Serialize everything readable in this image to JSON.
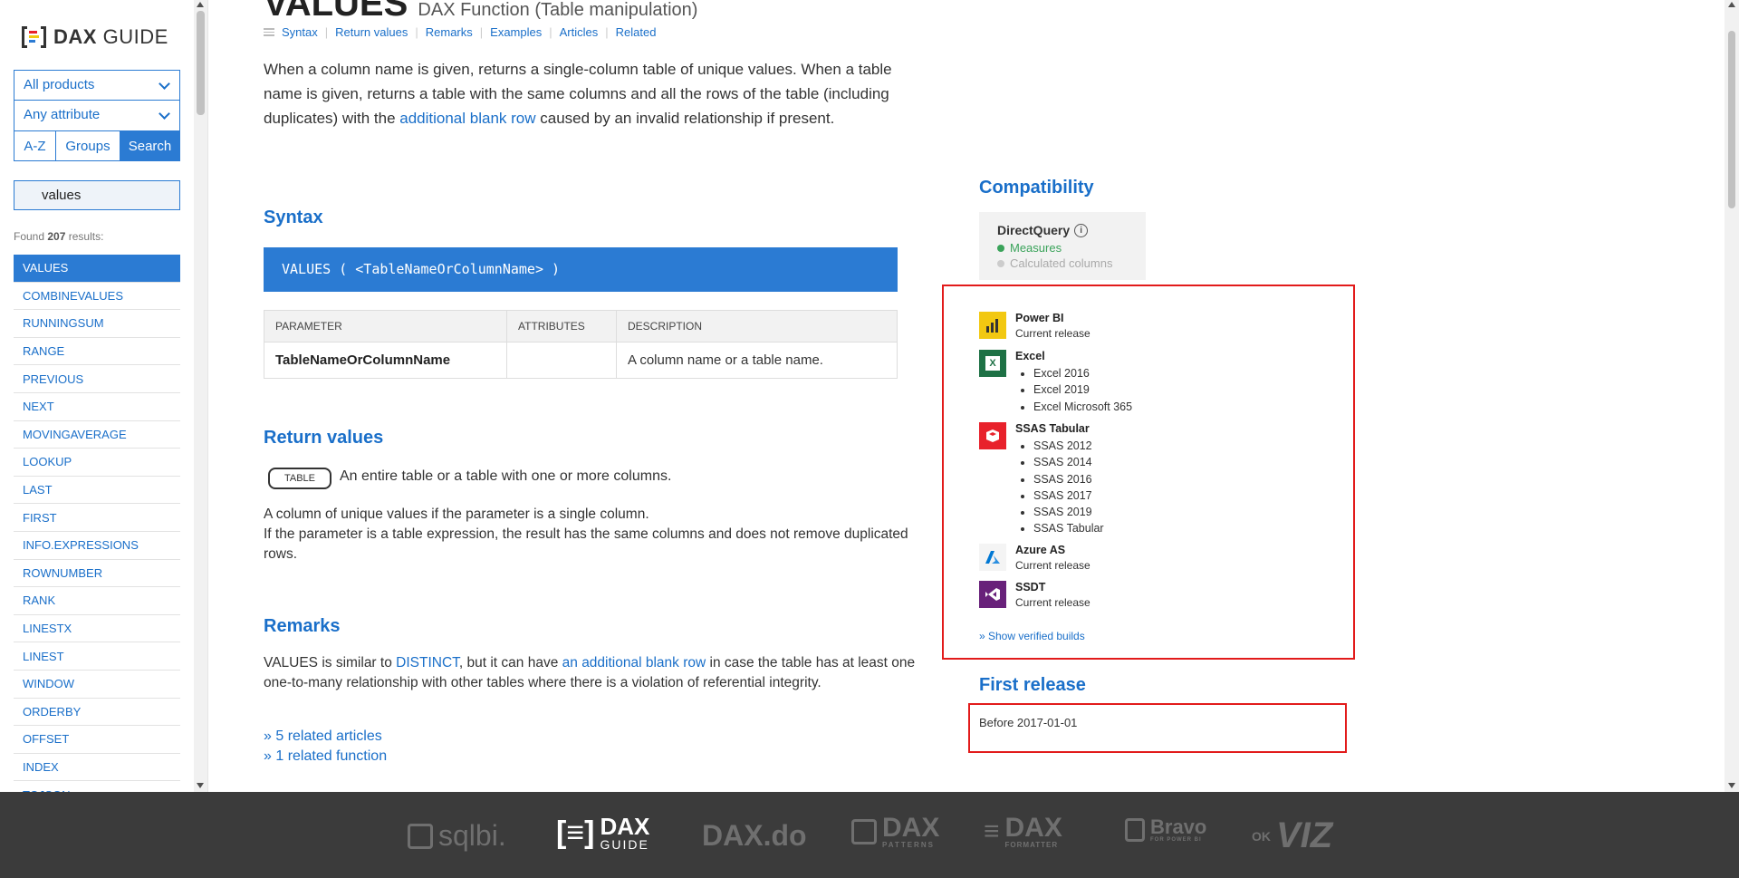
{
  "sidebar": {
    "logo": {
      "bold": "DAX",
      "light": "GUIDE"
    },
    "product_select": "All products",
    "attribute_select": "Any attribute",
    "tabs": [
      "A-Z",
      "Groups",
      "Search"
    ],
    "search_value": "values",
    "found_prefix": "Found ",
    "found_count": "207",
    "found_suffix": " results:",
    "results": [
      "VALUES",
      "COMBINEVALUES",
      "RUNNINGSUM",
      "RANGE",
      "PREVIOUS",
      "NEXT",
      "MOVINGAVERAGE",
      "LOOKUP",
      "LAST",
      "FIRST",
      "INFO.EXPRESSIONS",
      "ROWNUMBER",
      "RANK",
      "LINESTX",
      "LINEST",
      "WINDOW",
      "ORDERBY",
      "OFFSET",
      "INDEX",
      "TOJSON"
    ]
  },
  "page": {
    "title": "VALUES",
    "subtitle": "DAX Function (Table manipulation)",
    "subnav": [
      "Syntax",
      "Return values",
      "Remarks",
      "Examples",
      "Articles",
      "Related"
    ],
    "intro_1": "When a column name is given, returns a single-column table of unique values. When a table name is given, returns a table with the same columns and all the rows of the table (including duplicates) with the ",
    "intro_link": "additional blank row",
    "intro_2": " caused by an invalid relationship if present.",
    "syntax_heading": "Syntax",
    "syntax_code": "VALUES ( <TableNameOrColumnName> )",
    "param_headers": [
      "PARAMETER",
      "ATTRIBUTES",
      "DESCRIPTION"
    ],
    "param_name": "TableNameOrColumnName",
    "param_attributes": "",
    "param_desc": "A column name or a table name.",
    "return_heading": "Return values",
    "return_badge": "TABLE",
    "return_desc": "An entire table or a table with one or more columns.",
    "return_line_1": "A column of unique values if the parameter is a single column.",
    "return_line_2": "If the parameter is a table expression, the result has the same columns and does not remove duplicated rows.",
    "remarks_heading": "Remarks",
    "remarks_1": "VALUES is similar to ",
    "remarks_link_1": "DISTINCT",
    "remarks_2": ", but it can have ",
    "remarks_link_2": "an additional blank row",
    "remarks_3": " in case the table has at least one one-to-many relationship with other tables where there is a violation of referential integrity.",
    "related_articles": "» 5 related articles",
    "related_function": "» 1 related function"
  },
  "compat": {
    "title": "Compatibility",
    "dq_title": "DirectQuery",
    "dq_measures": "Measures",
    "dq_calc": "Calculated columns",
    "products": [
      {
        "name": "Power BI",
        "sub": "Current release",
        "icon": "power-bi-icon",
        "color": "#f2c811"
      },
      {
        "name": "Excel",
        "list": [
          "Excel 2016",
          "Excel 2019",
          "Excel Microsoft 365"
        ],
        "icon": "excel-icon",
        "color": "#1e7145"
      },
      {
        "name": "SSAS Tabular",
        "list": [
          "SSAS 2012",
          "SSAS 2014",
          "SSAS 2016",
          "SSAS 2017",
          "SSAS 2019",
          "SSAS Tabular"
        ],
        "icon": "ssas-icon",
        "color": "#e8212b"
      },
      {
        "name": "Azure AS",
        "sub": "Current release",
        "icon": "azure-icon",
        "color": "#0078d4"
      },
      {
        "name": "SSDT",
        "sub": "Current release",
        "icon": "ssdt-icon",
        "color": "#68217a"
      }
    ],
    "show_builds": "» Show verified builds",
    "first_release_title": "First release",
    "first_release_value": "Before 2017-01-01"
  },
  "footer": {
    "brands": [
      "sqlbi.",
      "DAX",
      "GUIDE",
      "DAX.do",
      "DAX",
      "PATTERNS",
      "DAX",
      "FORMATTER",
      "Bravo",
      "FOR POWER BI",
      "OK",
      "VIZ"
    ]
  },
  "colors": {
    "accent": "#2b7bd3",
    "highlight_border": "#e21b1b",
    "footer_bg": "#3b3b3b"
  }
}
